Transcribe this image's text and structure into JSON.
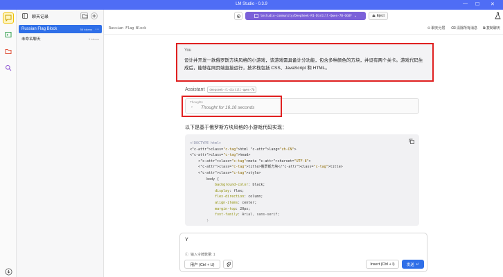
{
  "window": {
    "title": "LM Studio - 0.3.9",
    "minimize": "—",
    "maximize": "☐",
    "close": "✕"
  },
  "sidebar": {
    "title": "聊天记录",
    "chats": [
      {
        "label": "Russian Flag Block",
        "meta": "56 tokens"
      },
      {
        "label": "未命名聊天",
        "meta": "0 tokens"
      }
    ]
  },
  "toolbar": {
    "model_name": "lmstudio-community/DeepSeek-R1-Distill-Qwen-7B-GGUF",
    "eject_label": "Eject"
  },
  "breadcrumb": "Russian Flag Block",
  "chat_actions": {
    "share": "聊天分层",
    "clear": "清除所有消息",
    "duplicate": "复制聊天"
  },
  "user_message": {
    "role": "You",
    "text": "设计并开发一款俄罗斯方块风格的小游戏，该游戏需具备计分功能，包含多种颜色的方块，并设有两个关卡。游戏代码生成后，能够在网页端直接运行，技术栈包括 CSS、JavaScript 和 HTML。"
  },
  "assistant": {
    "role": "Assistant",
    "model_tag": "deepseek-r1-distill-qwen-7b",
    "thoughts_label": "Thoughts",
    "thoughts_text": "Thought for 16.16 seconds",
    "intro": "以下是基于俄罗斯方块风格的小游戏代码实现：",
    "code_lines": [
      "<!DOCTYPE html>",
      "<html lang=\"zh-CN\">",
      "<head>",
      "    <meta charset=\"UTF-8\">",
      "    <title>俄罗斯方块</title>",
      "    <style>",
      "        body {",
      "            background-color: black;",
      "            display: flex;",
      "            flex-direction: column;",
      "            align-items: center;",
      "            margin-top: 20px;",
      "            font-family: Arial, sans-serif;",
      "        }"
    ]
  },
  "composer": {
    "input_value": "Y",
    "token_label": "输入令牌数量: 1",
    "role_button": "用户 (Ctrl + U)",
    "insert_button": "Insert (Ctrl + I)",
    "send_button": "发送"
  },
  "colors": {
    "accent": "#2f6fe8",
    "titlebar": "#4f6df5",
    "model_pill": "#7b61d9",
    "highlight": "#e02020"
  }
}
